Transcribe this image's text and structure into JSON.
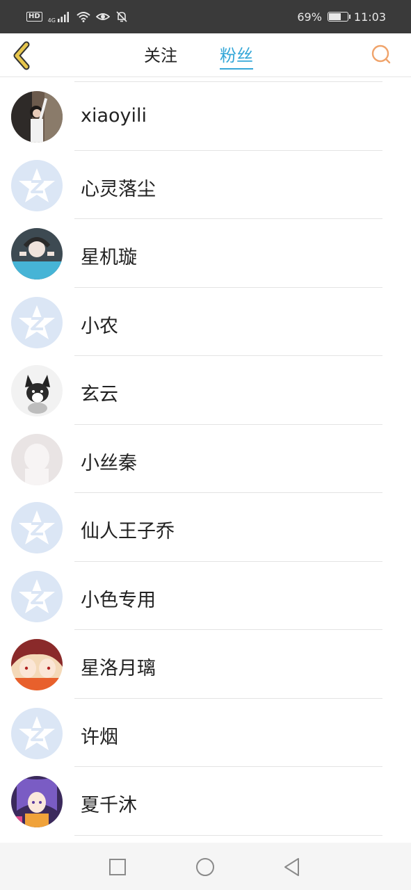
{
  "status_bar": {
    "hd": "HD",
    "network": "4G",
    "battery_percent": "69%",
    "battery_level": 0.69,
    "time": "11:03",
    "icons": [
      "hd-icon",
      "signal-icon",
      "wifi-icon",
      "eye-icon",
      "mute-bell-icon",
      "battery-charging-icon"
    ]
  },
  "header": {
    "back_icon": "chevron-left-icon",
    "tabs": [
      {
        "label": "关注",
        "active": false
      },
      {
        "label": "粉丝",
        "active": true
      }
    ],
    "search_icon": "search-icon",
    "accent_color": "#34a7d8",
    "back_color": "#e7c64d",
    "search_color": "#f0a36a"
  },
  "fans": [
    {
      "name": "xiaoyili",
      "avatar": "photo-avatar"
    },
    {
      "name": "心灵落尘",
      "avatar": "default-qq-avatar"
    },
    {
      "name": "星机璇",
      "avatar": "photo-avatar"
    },
    {
      "name": "小农",
      "avatar": "default-qq-avatar"
    },
    {
      "name": "玄云",
      "avatar": "sketch-dog-avatar"
    },
    {
      "name": "小丝秦",
      "avatar": "default-silhouette-avatar"
    },
    {
      "name": "仙人王子乔",
      "avatar": "default-qq-avatar"
    },
    {
      "name": "小色专用",
      "avatar": "default-qq-avatar"
    },
    {
      "name": "星洛月璃",
      "avatar": "anime-avatar"
    },
    {
      "name": "许烟",
      "avatar": "default-qq-avatar"
    },
    {
      "name": "夏千沐",
      "avatar": "anime-avatar"
    }
  ],
  "nav_bar": {
    "icons": [
      "recent-apps-icon",
      "home-icon",
      "back-icon"
    ]
  }
}
